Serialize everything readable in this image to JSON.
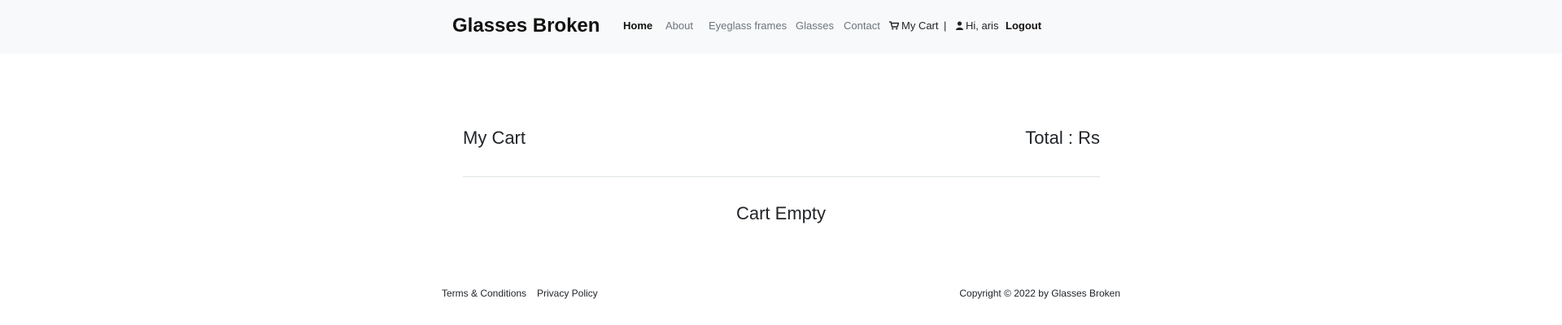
{
  "navbar": {
    "brand": "Glasses Broken",
    "links": {
      "home": "Home",
      "about": "About",
      "eyeglass_frames": "Eyeglass frames",
      "glasses": "Glasses",
      "contact": "Contact"
    },
    "cart_label": "My Cart",
    "separator": "|",
    "greeting": "Hi, aris",
    "logout": "Logout",
    "icons": {
      "cart": "shopping-cart-icon",
      "user": "user-icon"
    }
  },
  "main": {
    "title": "My Cart",
    "total_label": "Total : Rs",
    "empty_message": "Cart Empty"
  },
  "footer": {
    "links": {
      "terms": "Terms & Conditions",
      "privacy": "Privacy Policy"
    },
    "copyright": "Copyright © 2022 by Glasses Broken"
  },
  "colors": {
    "navbar_bg": "#f8f9fa",
    "muted_link": "#6c757d",
    "text": "#212529",
    "divider": "#dee2e6"
  }
}
